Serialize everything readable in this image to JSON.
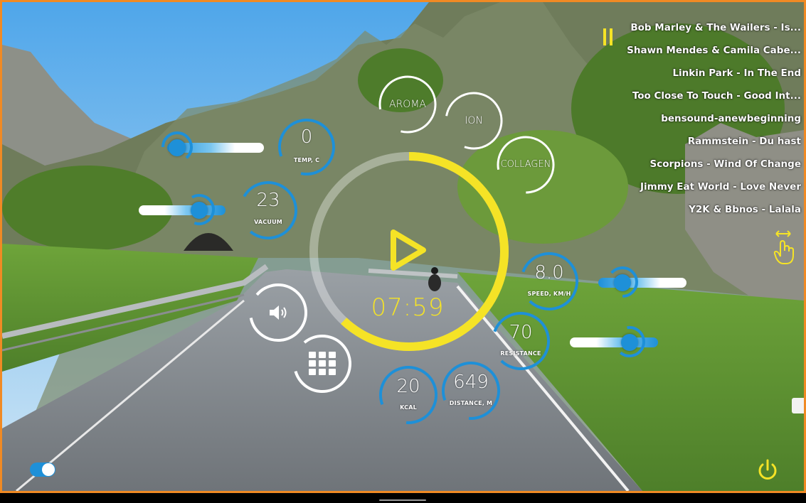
{
  "playlist": {
    "tracks": [
      "Bob Marley & The Wailers - Is...",
      "Shawn Mendes & Camila Cabe...",
      "Linkin Park - In The End",
      "Too Close To Touch - Good Int...",
      "bensound-anewbeginning",
      "Rammstein - Du hast",
      "Scorpions - Wind Of Change",
      "Jimmy Eat World - Love Never",
      "Y2K & Bbnos - Lalala"
    ]
  },
  "metrics": {
    "temp": {
      "value": "0",
      "label": "TEMP, C"
    },
    "vacuum": {
      "value": "23",
      "label": "VACUUM"
    },
    "speed": {
      "value": "8.0",
      "label": "SPEED, KM/H"
    },
    "resistance": {
      "value": "70",
      "label": "RESISTANCE"
    },
    "kcal": {
      "value": "20",
      "label": "KCAL"
    },
    "distance": {
      "value": "649",
      "label": "DISTANCE, M"
    }
  },
  "modes": {
    "aroma": "AROMA",
    "ion": "ION",
    "collagen": "COLLAGEN"
  },
  "player": {
    "timer": "07:59",
    "progress": 0.62
  },
  "sliders": {
    "temp_level": 0.05,
    "vacuum_level": 0.7,
    "speed_level": 0.25,
    "resistance_level": 0.65
  },
  "toggle": {
    "on": true
  },
  "colors": {
    "accent": "#f5e326",
    "blue": "#1e90d8",
    "frame": "#f08a24"
  },
  "icons": [
    "pause-icon",
    "play-icon",
    "volume-icon",
    "grid-menu-icon",
    "hand-swipe-icon",
    "power-icon"
  ]
}
